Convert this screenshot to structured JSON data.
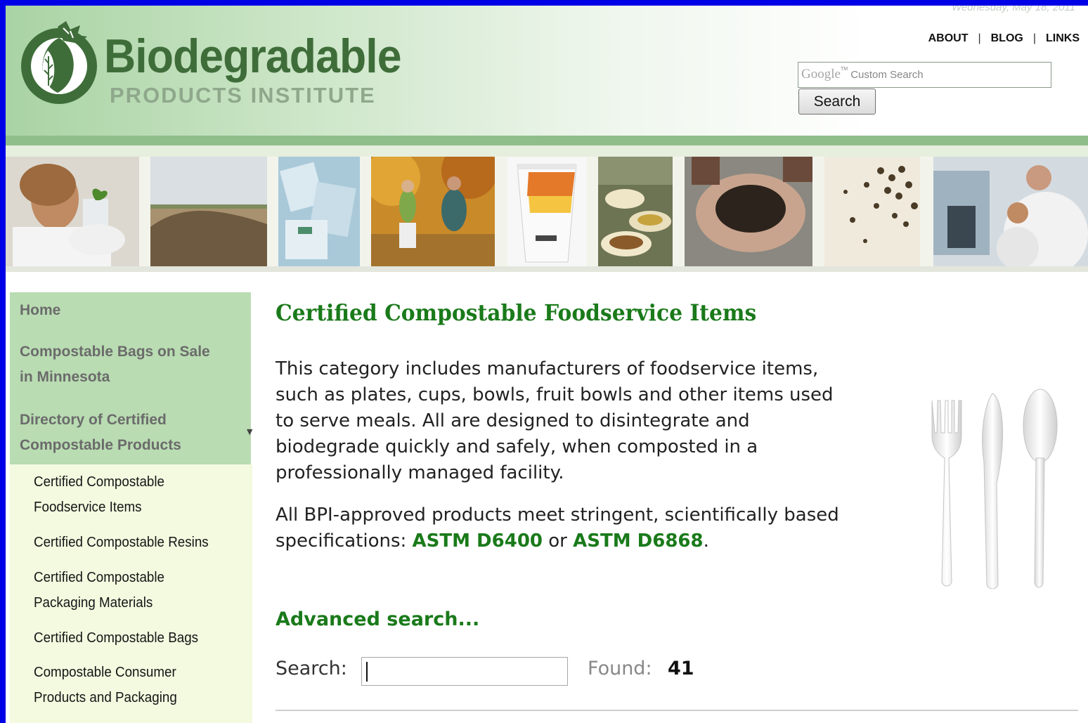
{
  "header": {
    "date": "Wednesday, May 18, 2011",
    "logo_title": "Biodegradable",
    "logo_subtitle": "PRODUCTS  INSTITUTE",
    "top_links": [
      "ABOUT",
      "BLOG",
      "LINKS"
    ],
    "search_brand": "Google",
    "search_placeholder": "Custom Search",
    "search_button": "Search"
  },
  "sidebar": {
    "main_items": [
      {
        "label": "Home"
      },
      {
        "label": "Compostable Bags on Sale",
        "label2": "in Minnesota"
      },
      {
        "label": "Directory of Certified",
        "label2": "Compostable Products"
      }
    ],
    "sub_items": [
      {
        "label": "Certified Compostable",
        "label2": "Foodservice Items"
      },
      {
        "label": "Certified Compostable Resins"
      },
      {
        "label": "Certified Compostable",
        "label2": "Packaging Materials"
      },
      {
        "label": "Certified Compostable Bags"
      },
      {
        "label": "Compostable Consumer",
        "label2": "Products and Packaging"
      }
    ]
  },
  "main": {
    "title": "Certified Compostable Foodservice Items",
    "para1": [
      "This category includes manufacturers of foodservice items,",
      "such as plates, cups, bowls, fruit bowls and other items used",
      "to serve meals. All are designed to disintegrate and",
      "biodegrade quickly and safely, when composted in a",
      "professionally managed facility."
    ],
    "para2_line1": "All BPI-approved products meet stringent, scientifically based",
    "para2_prefix": "specifications: ",
    "link1": "ASTM D6400",
    "para2_or": " or ",
    "link2": "ASTM D6868",
    "para2_end": ".",
    "advanced_search": "Advanced search...",
    "search_label": "Search:",
    "search_value": "",
    "found_label": "Found:",
    "found_value": "41"
  },
  "colors": {
    "brand_green": "#3f6d3a",
    "title_green": "#1a7a1a",
    "sidebar_top_bg": "#b9dcb2",
    "sidebar_bottom_bg": "#f3fae0",
    "frame_blue": "#0000e6"
  }
}
